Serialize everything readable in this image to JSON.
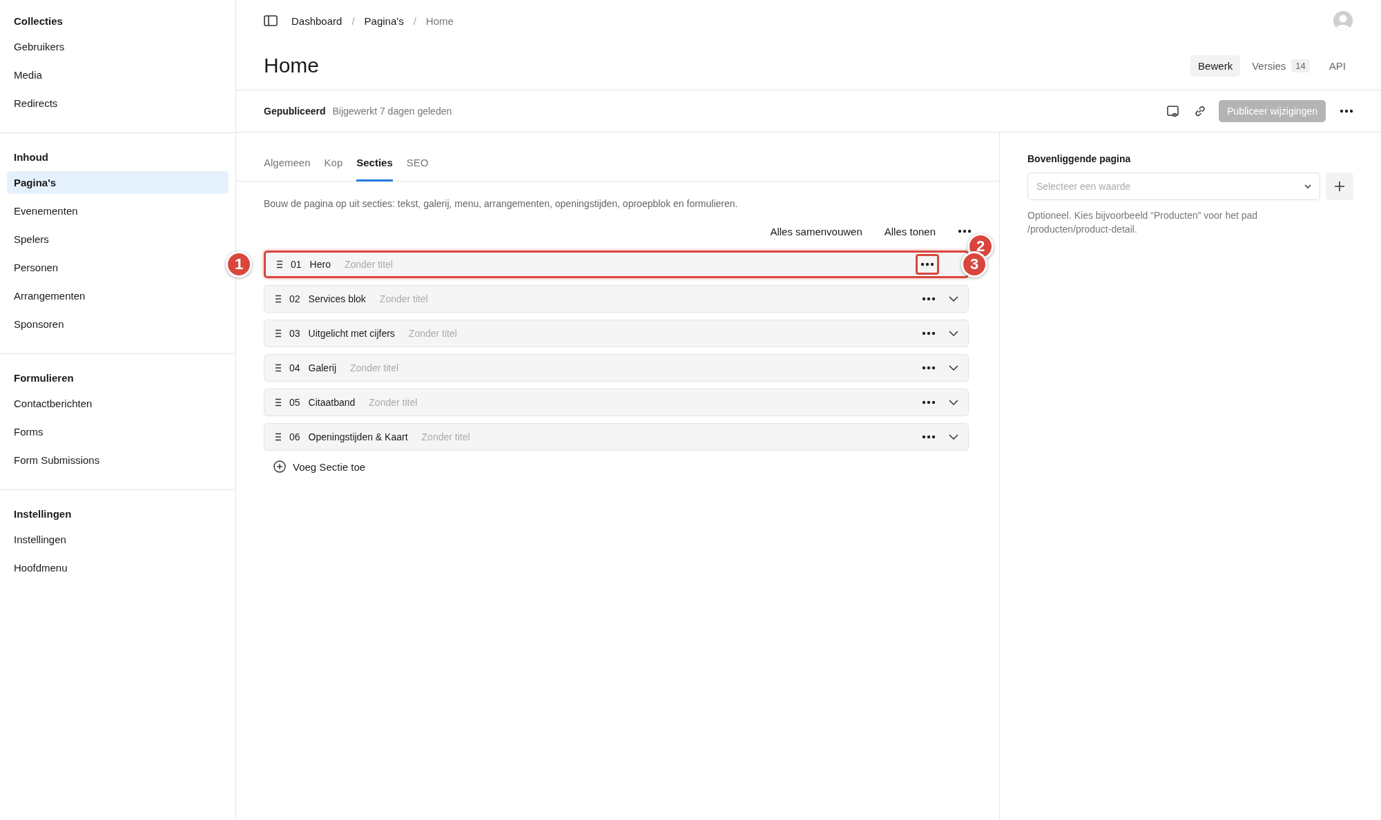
{
  "sidebar": {
    "groups": [
      {
        "title": "Collecties",
        "items": [
          {
            "label": "Gebruikers",
            "selected": false
          },
          {
            "label": "Media",
            "selected": false
          },
          {
            "label": "Redirects",
            "selected": false
          }
        ]
      },
      {
        "title": "Inhoud",
        "items": [
          {
            "label": "Pagina's",
            "selected": true
          },
          {
            "label": "Evenementen",
            "selected": false
          },
          {
            "label": "Spelers",
            "selected": false
          },
          {
            "label": "Personen",
            "selected": false
          },
          {
            "label": "Arrangementen",
            "selected": false
          },
          {
            "label": "Sponsoren",
            "selected": false
          }
        ]
      },
      {
        "title": "Formulieren",
        "items": [
          {
            "label": "Contactberichten",
            "selected": false
          },
          {
            "label": "Forms",
            "selected": false
          },
          {
            "label": "Form Submissions",
            "selected": false
          }
        ]
      },
      {
        "title": "Instellingen",
        "items": [
          {
            "label": "Instellingen",
            "selected": false
          },
          {
            "label": "Hoofdmenu",
            "selected": false
          }
        ]
      }
    ]
  },
  "breadcrumb": [
    {
      "label": "Dashboard",
      "current": false
    },
    {
      "separator": "/",
      "label": "Pagina's",
      "current": false
    },
    {
      "separator": "/",
      "label": "Home",
      "current": true
    }
  ],
  "title": "Home",
  "view_tabs": [
    {
      "label": "Bewerk",
      "selected": true
    },
    {
      "label": "Versies",
      "selected": false,
      "count": "14"
    },
    {
      "label": "API",
      "selected": false
    }
  ],
  "status": {
    "state": "Gepubliceerd",
    "updated": "Bijgewerkt 7 dagen geleden"
  },
  "publish_button": {
    "label": "Publiceer wijzigingen",
    "disabled": true
  },
  "tabs": [
    {
      "label": "Algemeen",
      "selected": false
    },
    {
      "label": "Kop",
      "selected": false
    },
    {
      "label": "Secties",
      "selected": true
    },
    {
      "label": "SEO",
      "selected": false
    }
  ],
  "description": "Bouw de pagina op uit secties: tekst, galerij, menu, arrangementen, openingstijden, oproepblok en formulieren.",
  "actions": [
    "Alles samenvouwen",
    "Alles tonen"
  ],
  "sections": [
    {
      "number": "01",
      "name": "Hero",
      "subtitle": "Zonder titel",
      "highlighted": true,
      "menu_highlighted": true,
      "chevron_visible": false
    },
    {
      "number": "02",
      "name": "Services blok",
      "subtitle": "Zonder titel",
      "highlighted": false,
      "menu_highlighted": false,
      "chevron_visible": true
    },
    {
      "number": "03",
      "name": "Uitgelicht met cijfers",
      "subtitle": "Zonder titel",
      "highlighted": false,
      "menu_highlighted": false,
      "chevron_visible": true
    },
    {
      "number": "04",
      "name": "Galerij",
      "subtitle": "Zonder titel",
      "highlighted": false,
      "menu_highlighted": false,
      "chevron_visible": true
    },
    {
      "number": "05",
      "name": "Citaatband",
      "subtitle": "Zonder titel",
      "highlighted": false,
      "menu_highlighted": false,
      "chevron_visible": true
    },
    {
      "number": "06",
      "name": "Openingstijden & Kaart",
      "subtitle": "Zonder titel",
      "highlighted": false,
      "menu_highlighted": false,
      "chevron_visible": true
    }
  ],
  "callouts": [
    {
      "label": "1"
    },
    {
      "label": "2"
    },
    {
      "label": "3"
    }
  ],
  "add_button": "Voeg Sectie toe",
  "parent_field": {
    "label": "Bovenliggende pagina",
    "placeholder": "Selecteer een waarde",
    "help": "Optioneel. Kies bijvoorbeeld “Producten” voor het pad /producten/product-detail."
  }
}
